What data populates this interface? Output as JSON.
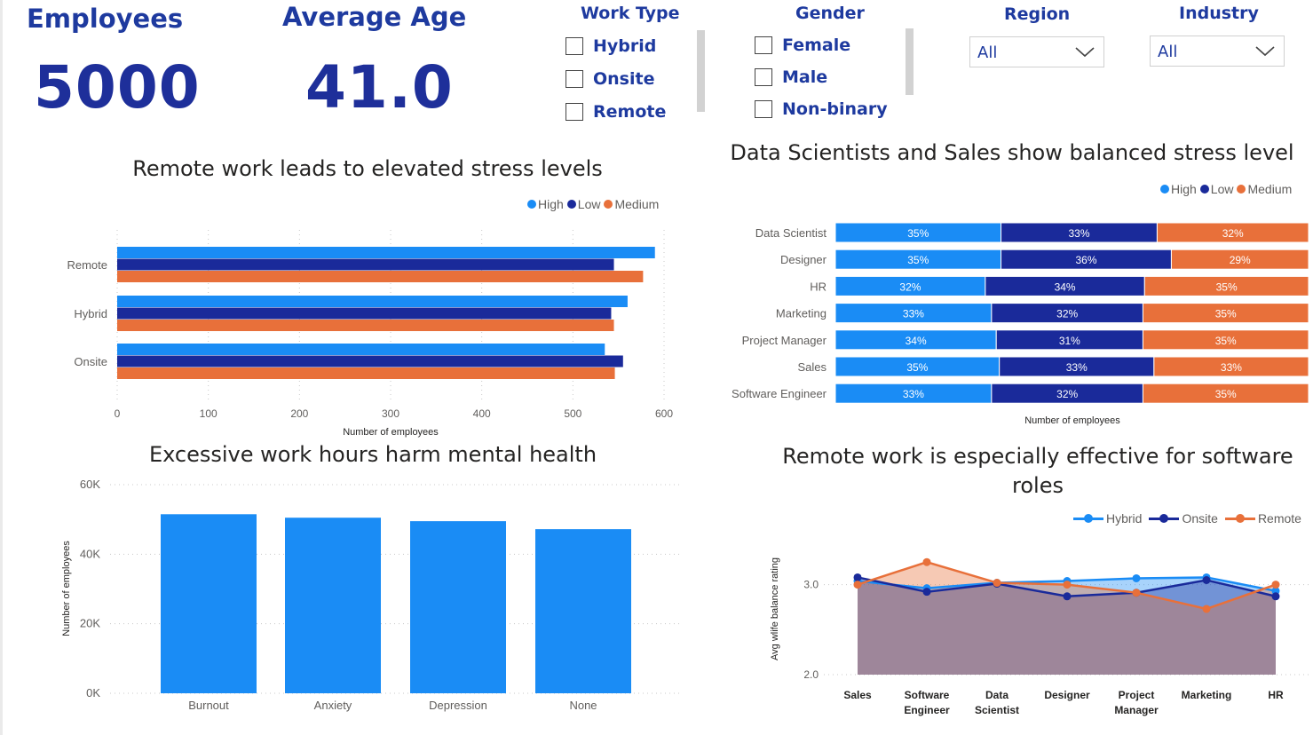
{
  "colors": {
    "high": "#1a8cf5",
    "low": "#1a2a9a",
    "medium": "#e8703a",
    "hybrid": "#1a8cf5",
    "onsite": "#1a2a9a",
    "remote": "#e8703a",
    "bar": "#1a8cf5"
  },
  "kpis": {
    "employees": {
      "label": "Employees",
      "value": "5000"
    },
    "average_age": {
      "label": "Average Age",
      "value": "41.0"
    }
  },
  "slicers": {
    "work_type": {
      "title": "Work Type",
      "options": [
        "Hybrid",
        "Onsite",
        "Remote"
      ]
    },
    "gender": {
      "title": "Gender",
      "options": [
        "Female",
        "Male",
        "Non-binary"
      ]
    },
    "region": {
      "title": "Region",
      "selected": "All"
    },
    "industry": {
      "title": "Industry",
      "selected": "All"
    }
  },
  "chart_data": [
    {
      "id": "stress_by_work_type",
      "type": "bar",
      "orientation": "horizontal",
      "title": "Remote work leads to elevated stress levels",
      "xlabel": "Number of employees",
      "ylabel": "",
      "xlim": [
        0,
        600
      ],
      "xticks": [
        0,
        100,
        200,
        300,
        400,
        500,
        600
      ],
      "grid": true,
      "legend_position": "top-right",
      "categories": [
        "Remote",
        "Hybrid",
        "Onsite"
      ],
      "series": [
        {
          "name": "High",
          "color": "#1a8cf5",
          "values": [
            590,
            560,
            535
          ]
        },
        {
          "name": "Low",
          "color": "#1a2a9a",
          "values": [
            545,
            542,
            555
          ]
        },
        {
          "name": "Medium",
          "color": "#e8703a",
          "values": [
            577,
            545,
            546
          ]
        }
      ]
    },
    {
      "id": "stress_by_job_role",
      "type": "bar",
      "orientation": "horizontal",
      "stacking": "100%",
      "title": "Data Scientists and Sales show balanced stress level",
      "xlabel": "Number of employees",
      "legend_position": "top-right",
      "categories": [
        "Data Scientist",
        "Designer",
        "HR",
        "Marketing",
        "Project Manager",
        "Sales",
        "Software Engineer"
      ],
      "series": [
        {
          "name": "High",
          "color": "#1a8cf5",
          "values": [
            35,
            35,
            32,
            33,
            34,
            35,
            33
          ],
          "labels": [
            "35%",
            "35%",
            "32%",
            "33%",
            "34%",
            "35%",
            "33%"
          ]
        },
        {
          "name": "Low",
          "color": "#1a2a9a",
          "values": [
            33,
            36,
            34,
            32,
            31,
            33,
            32
          ],
          "labels": [
            "33%",
            "36%",
            "34%",
            "32%",
            "31%",
            "33%",
            "32%"
          ]
        },
        {
          "name": "Medium",
          "color": "#e8703a",
          "values": [
            32,
            29,
            35,
            35,
            35,
            33,
            35
          ],
          "labels": [
            "32%",
            "29%",
            "35%",
            "35%",
            "35%",
            "33%",
            "35%"
          ]
        }
      ]
    },
    {
      "id": "mental_health",
      "type": "bar",
      "title": "Excessive work hours harm mental health",
      "xlabel": "",
      "ylabel": "Number of employees",
      "ylim": [
        0,
        60000
      ],
      "yticks": [
        0,
        20000,
        40000,
        60000
      ],
      "ytick_labels": [
        "0K",
        "20K",
        "40K",
        "60K"
      ],
      "grid": true,
      "categories": [
        "Burnout",
        "Anxiety",
        "Depression",
        "None"
      ],
      "values": [
        51500,
        50500,
        49500,
        47200
      ]
    },
    {
      "id": "work_life_balance",
      "type": "area",
      "title": "Remote work is especially effective for software roles",
      "ylabel": "Avg wlife balance rating",
      "ylim": [
        2.0,
        3.4
      ],
      "yticks": [
        2.0,
        3.0
      ],
      "ytick_labels": [
        "2.0",
        "3.0"
      ],
      "grid": true,
      "legend_position": "top-right",
      "categories": [
        "Sales",
        "Software Engineer",
        "Data Scientist",
        "Designer",
        "Project Manager",
        "Marketing",
        "HR"
      ],
      "category_lines": [
        [
          "Sales"
        ],
        [
          "Software",
          "Engineer"
        ],
        [
          "Data",
          "Scientist"
        ],
        [
          "Designer"
        ],
        [
          "Project",
          "Manager"
        ],
        [
          "Marketing"
        ],
        [
          "HR"
        ]
      ],
      "series": [
        {
          "name": "Hybrid",
          "color": "#1a8cf5",
          "values": [
            3.04,
            2.96,
            3.02,
            3.04,
            3.07,
            3.08,
            2.93
          ]
        },
        {
          "name": "Onsite",
          "color": "#1a2a9a",
          "values": [
            3.08,
            2.92,
            3.01,
            2.87,
            2.91,
            3.05,
            2.87
          ]
        },
        {
          "name": "Remote",
          "color": "#e8703a",
          "values": [
            3.0,
            3.25,
            3.02,
            3.0,
            2.91,
            2.73,
            3.0
          ]
        }
      ]
    }
  ]
}
